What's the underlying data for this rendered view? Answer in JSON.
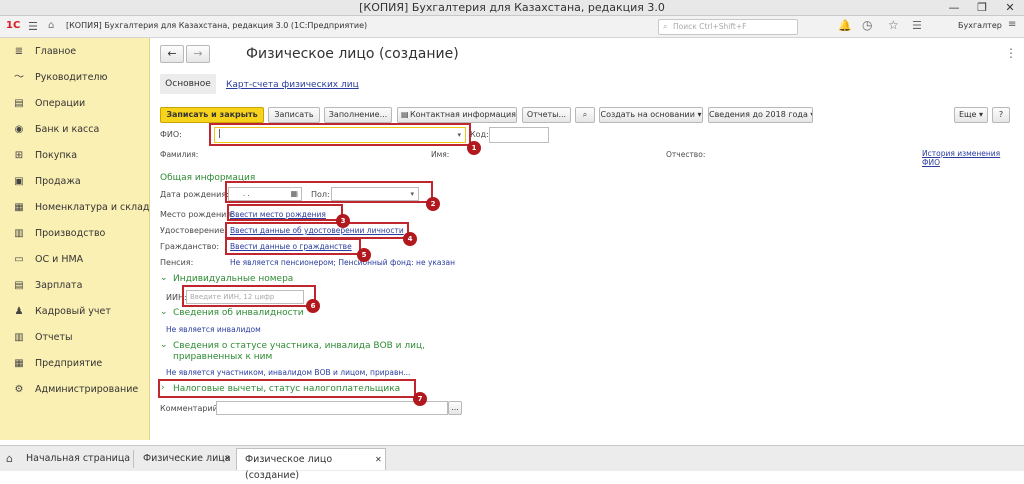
{
  "window": {
    "title": "[КОПИЯ] Бухгалтерия для Казахстана, редакция 3.0"
  },
  "appbar": {
    "logo": "1С",
    "title": "[КОПИЯ] Бухгалтерия для Казахстана, редакция 3.0  (1С:Предприятие)",
    "search_placeholder": "Поиск Ctrl+Shift+F",
    "user": "Бухгалтер"
  },
  "sidebar": {
    "items": [
      {
        "label": "Главное",
        "icon": "menu-icon"
      },
      {
        "label": "Руководителю",
        "icon": "chart-icon"
      },
      {
        "label": "Операции",
        "icon": "folder-icon"
      },
      {
        "label": "Банк и касса",
        "icon": "coin-icon"
      },
      {
        "label": "Покупка",
        "icon": "cart-icon"
      },
      {
        "label": "Продажа",
        "icon": "bag-icon"
      },
      {
        "label": "Номенклатура и склад",
        "icon": "warehouse-icon"
      },
      {
        "label": "Производство",
        "icon": "factory-icon"
      },
      {
        "label": "ОС и НМА",
        "icon": "truck-icon"
      },
      {
        "label": "Зарплата",
        "icon": "money-icon"
      },
      {
        "label": "Кадровый учет",
        "icon": "people-icon"
      },
      {
        "label": "Отчеты",
        "icon": "report-icon"
      },
      {
        "label": "Предприятие",
        "icon": "building-icon"
      },
      {
        "label": "Администрирование",
        "icon": "gear-icon"
      }
    ]
  },
  "form": {
    "title": "Физическое лицо (создание)",
    "tabs": {
      "main": "Основное",
      "accounts": "Карт-счета физических лиц"
    },
    "toolbar": {
      "save_close": "Записать и закрыть",
      "save": "Записать",
      "fill": "Заполнение...",
      "contact": "Контактная информация",
      "reports": "Отчеты...",
      "create_based": "Создать на основании",
      "info2018": "Сведения до 2018 года",
      "more": "Еще",
      "help": "?"
    },
    "fio_label": "ФИО:",
    "code_label": "Код:",
    "surname_label": "Фамилия:",
    "name_label": "Имя:",
    "patronymic_label": "Отчество:",
    "history_link": "История изменения ФИО",
    "general_header": "Общая информация",
    "birth_label": "Дата рождения:",
    "birth_value": ". .",
    "gender_label": "Пол:",
    "birthplace_label": "Место рождения:",
    "birthplace_link": "Ввести место рождения",
    "id_label": "Удостоверение:",
    "id_link": "Ввести данные об удостоверении личности",
    "citizenship_label": "Гражданство:",
    "citizenship_link": "Ввести данные о гражданстве",
    "pension_label": "Пенсия:",
    "pension_link": "Не является пенсионером; Пенсионный фонд: не указан",
    "individual_header": "Индивидуальные номера",
    "iin_label": "ИИН:",
    "iin_placeholder": "Введите ИИН, 12 цифр",
    "disability_header": "Сведения об инвалидности",
    "disability_link": "Не является инвалидом",
    "veteran_header": "Сведения о статусе участника, инвалида ВОВ и лиц, приравненных к ним",
    "veteran_link": "Не является участником, инвалидом ВОВ и лицом, приравн...",
    "tax_header": "Налоговые вычеты, статус налогоплательщика",
    "comment_label": "Комментарий:",
    "comment_button": "..."
  },
  "markers": [
    "1",
    "2",
    "3",
    "4",
    "5",
    "6",
    "7"
  ],
  "taskbar": {
    "tabs": [
      "Начальная страница",
      "Физические лица",
      "Физическое лицо (создание)"
    ]
  },
  "colors": {
    "sidebar_bg": "#fbf0b4",
    "accent_button": "#f7d31c",
    "section_green": "#2e8b34",
    "link_blue": "#2a3d9e",
    "highlight_red": "#c0262d"
  }
}
